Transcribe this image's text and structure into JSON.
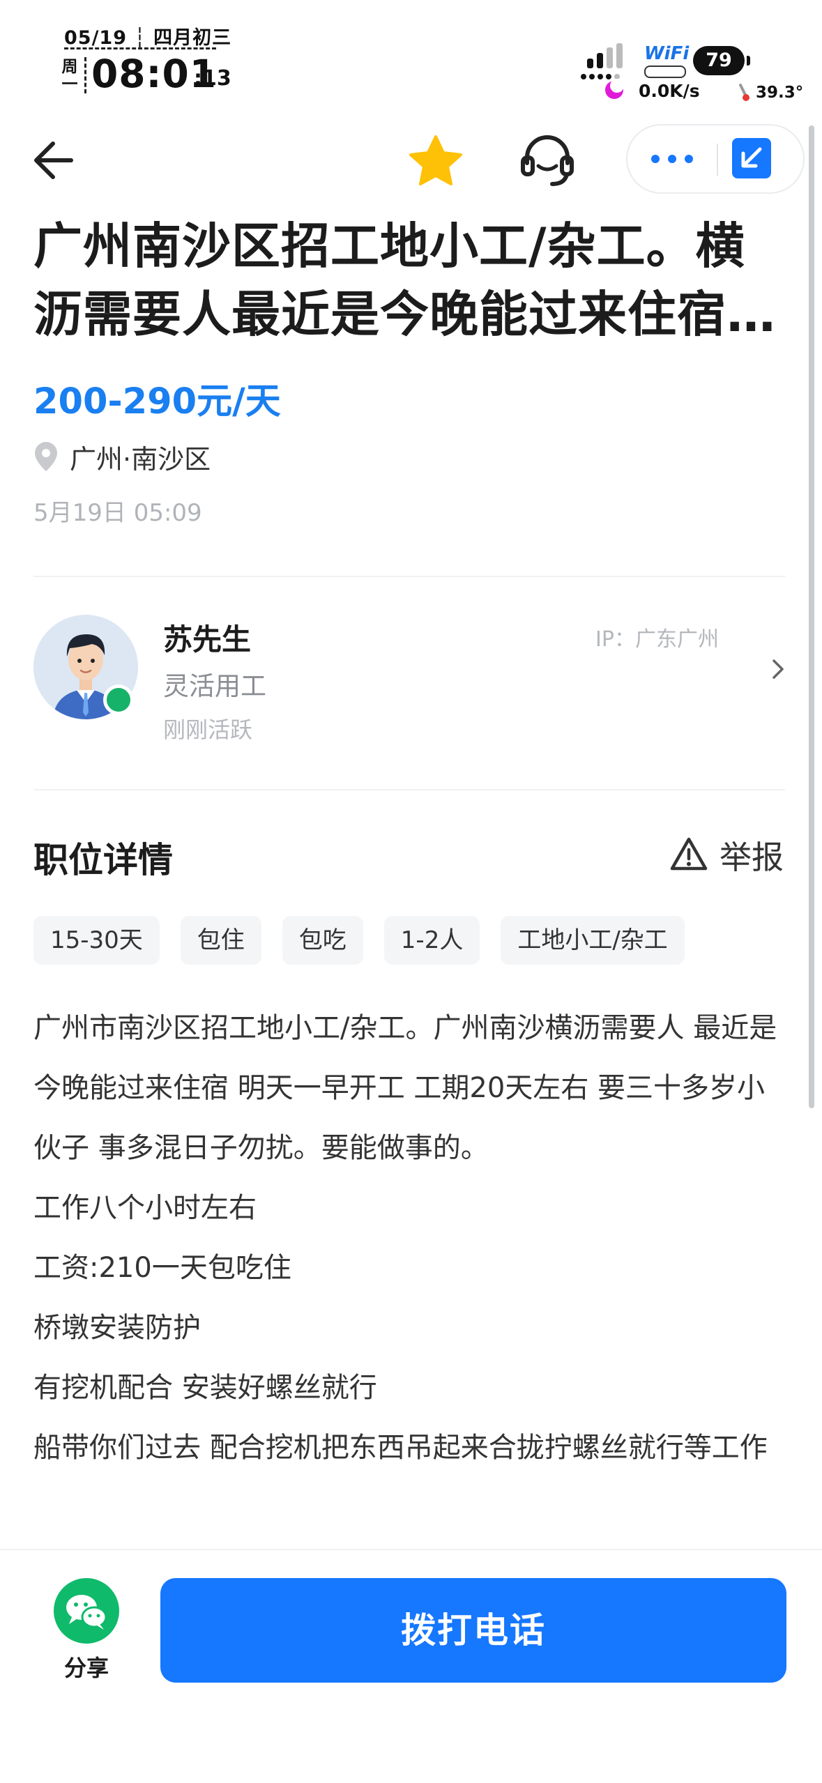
{
  "status_bar": {
    "date_line": "05/19 ┆ 四月初三",
    "weekday": "周一",
    "time": "08:01",
    "seconds": ":13",
    "wifi": "WiFi",
    "battery": "79",
    "net_speed": "0.0K/s",
    "temperature": "39.3°"
  },
  "nav": {
    "back_icon": "arrow-left",
    "favorite_icon": "star-filled",
    "service_icon": "headset",
    "more_icon": "more-dots",
    "exit_icon": "minimize-arrow"
  },
  "job": {
    "title": "广州南沙区招工地小工/杂工。横沥需要人最近是今晚能过来住宿 明天一早开工",
    "salary": "200-290元/天",
    "location": "广州·南沙区",
    "posted": "5月19日 05:09"
  },
  "employer": {
    "name": "苏先生",
    "role": "灵活用工",
    "active": "刚刚活跃",
    "ip": "IP：广东广州"
  },
  "details": {
    "title": "职位详情",
    "report": "举报",
    "tags": [
      "15-30天",
      "包住",
      "包吃",
      "1-2人",
      "工地小工/杂工"
    ],
    "description": [
      "广州市南沙区招工地小工/杂工。广州南沙横沥需要人 最近是今晚能过来住宿 明天一早开工 工期20天左右 要三十多岁小伙子 事多混日子勿扰。要能做事的。",
      "工作八个小时左右",
      "工资:210一天包吃住",
      "桥墩安装防护",
      "有挖机配合 安装好螺丝就行",
      "船带你们过去 配合挖机把东西吊起来合拢拧螺丝就行等工作"
    ]
  },
  "bottom": {
    "share": "分享",
    "call": "拨打电话"
  },
  "colors": {
    "accent": "#1677ff",
    "salary": "#1a7ff0",
    "star": "#ffc107",
    "online": "#17b26a",
    "wechat": "#0fba6b"
  }
}
